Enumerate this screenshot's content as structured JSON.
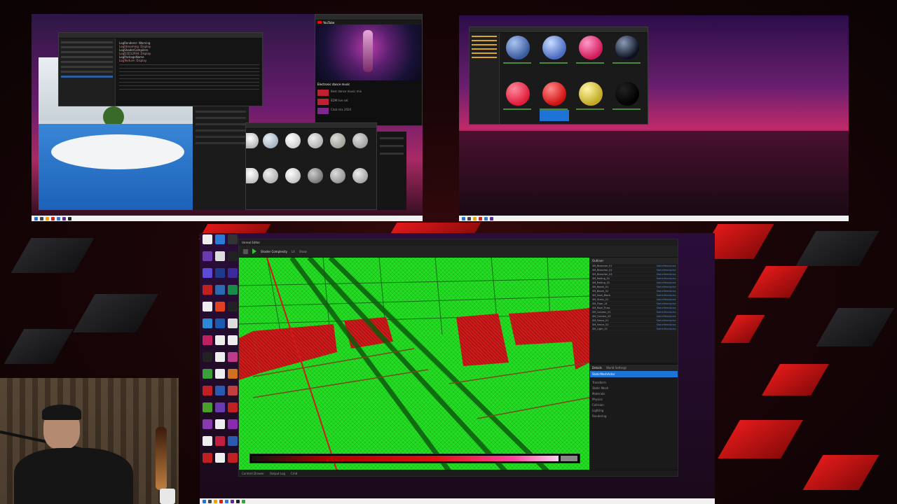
{
  "colors": {
    "background_red": "#e21a1a",
    "viewport_green": "#22dd22",
    "mesh_red": "#cc1a1a",
    "editor_dark": "#1e1e1e",
    "taskbar": "#f1f1f1",
    "selection_blue": "#1e73d6"
  },
  "monitor_top_left": {
    "console": {
      "title": "Console",
      "lines": [
        "LogRenderer: Warning",
        "LogStreaming: Display",
        "LogShaderCompilers",
        "LogD3D12RHI: Display",
        "LogPackageName",
        "LogTexture: Display"
      ]
    },
    "browser": {
      "tab": "YouTube",
      "video_title": "Electronic dance music",
      "related": [
        "Best dance music mix",
        "EDM live set",
        "Club mix 2024"
      ]
    },
    "material_library": {
      "sphere_count": 12
    }
  },
  "monitor_top_right": {
    "content_browser": {
      "title": "Content Browser",
      "selected_index": 5
    }
  },
  "main_editor": {
    "title": "Unreal Editor",
    "toolbar": {
      "view_mode": "Shader Complexity",
      "lit_label": "Lit",
      "show_label": "Show"
    },
    "outliner": {
      "title": "Outliner",
      "items": [
        {
          "label": "SM_Bleacher_01",
          "type": "StaticMeshActor"
        },
        {
          "label": "SM_Bleacher_02",
          "type": "StaticMeshActor"
        },
        {
          "label": "SM_Bleacher_03",
          "type": "StaticMeshActor"
        },
        {
          "label": "SM_Railing_01",
          "type": "StaticMeshActor"
        },
        {
          "label": "SM_Railing_02",
          "type": "StaticMeshActor"
        },
        {
          "label": "SM_Beam_01",
          "type": "StaticMeshActor"
        },
        {
          "label": "SM_Beam_02",
          "type": "StaticMeshActor"
        },
        {
          "label": "SM_Seat_Block",
          "type": "StaticMeshActor"
        },
        {
          "label": "SM_Stairs_01",
          "type": "StaticMeshActor"
        },
        {
          "label": "SM_Floor_01",
          "type": "StaticMeshActor"
        },
        {
          "label": "SM_Roof_Truss",
          "type": "StaticMeshActor"
        },
        {
          "label": "SM_Column_01",
          "type": "StaticMeshActor"
        },
        {
          "label": "SM_Column_02",
          "type": "StaticMeshActor"
        },
        {
          "label": "SM_Fence_01",
          "type": "StaticMeshActor"
        },
        {
          "label": "SM_Fence_02",
          "type": "StaticMeshActor"
        },
        {
          "label": "SM_Light_01",
          "type": "StaticMeshActor"
        }
      ]
    },
    "details": {
      "tab_details": "Details",
      "tab_world": "World Settings",
      "selected": "StaticMeshActor",
      "sections": [
        "Transform",
        "Static Mesh",
        "Materials",
        "Physics",
        "Collision",
        "Lighting",
        "Rendering"
      ]
    },
    "statusbar": {
      "content_drawer": "Content Drawer",
      "output_log": "Output Log",
      "cmd": "Cmd"
    }
  }
}
